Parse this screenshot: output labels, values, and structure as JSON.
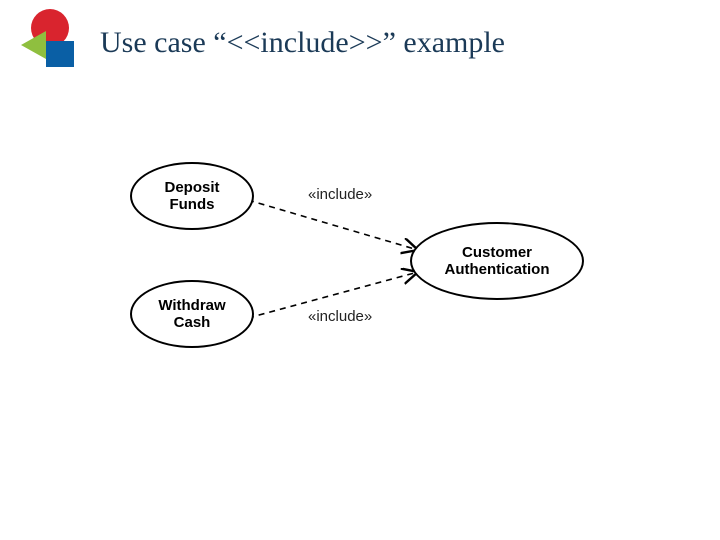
{
  "title": "Use case “<<include>>” example",
  "diagram": {
    "nodes": {
      "deposit": {
        "line1": "Deposit",
        "line2": "Funds"
      },
      "withdraw": {
        "line1": "Withdraw",
        "line2": "Cash"
      },
      "auth": {
        "line1": "Customer",
        "line2": "Authentication"
      }
    },
    "edges": {
      "top_label": "«include»",
      "bottom_label": "«include»"
    }
  }
}
